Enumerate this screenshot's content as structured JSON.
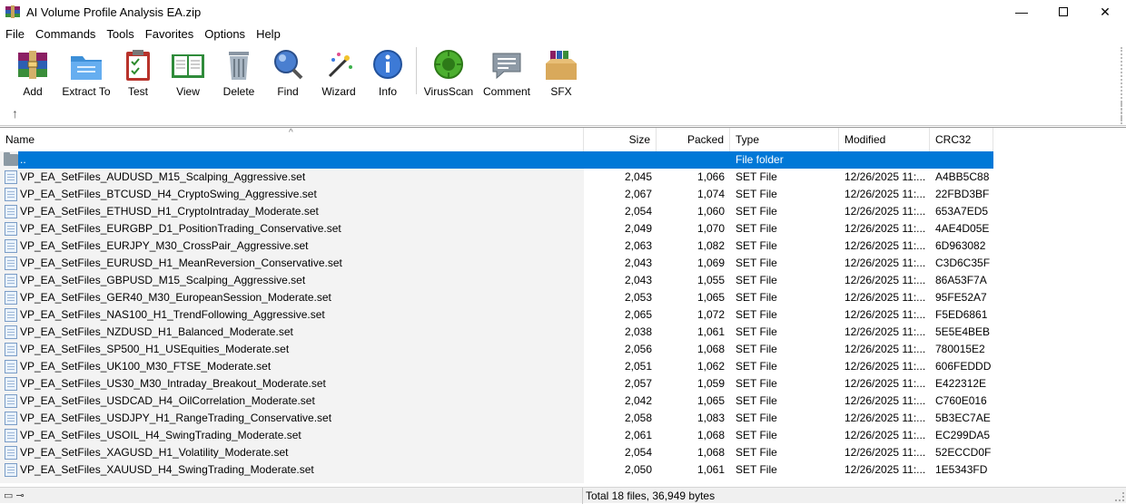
{
  "window": {
    "title": "AI Volume Profile Analysis EA.zip",
    "minimize": "—",
    "close": "✕"
  },
  "menu": [
    "File",
    "Commands",
    "Tools",
    "Favorites",
    "Options",
    "Help"
  ],
  "toolbar": [
    {
      "label": "Add",
      "icon": "add-archive-icon"
    },
    {
      "label": "Extract To",
      "icon": "extract-folder-icon"
    },
    {
      "label": "Test",
      "icon": "test-clipboard-icon"
    },
    {
      "label": "View",
      "icon": "view-book-icon"
    },
    {
      "label": "Delete",
      "icon": "trash-can-icon"
    },
    {
      "label": "Find",
      "icon": "magnifier-icon"
    },
    {
      "label": "Wizard",
      "icon": "magic-wand-icon"
    },
    {
      "label": "Info",
      "icon": "info-icon"
    },
    {
      "label": "VirusScan",
      "icon": "virus-scan-icon"
    },
    {
      "label": "Comment",
      "icon": "comment-icon"
    },
    {
      "label": "SFX",
      "icon": "sfx-box-icon"
    }
  ],
  "columns": {
    "name": "Name",
    "size": "Size",
    "packed": "Packed",
    "type": "Type",
    "modified": "Modified",
    "crc": "CRC32"
  },
  "parent_row": {
    "name": "..",
    "type": "File folder"
  },
  "files": [
    {
      "name": "VP_EA_SetFiles_AUDUSD_M15_Scalping_Aggressive.set",
      "size": "2,045",
      "packed": "1,066",
      "type": "SET File",
      "modified": "12/26/2025 11:...",
      "crc": "A4BB5C88"
    },
    {
      "name": "VP_EA_SetFiles_BTCUSD_H4_CryptoSwing_Aggressive.set",
      "size": "2,067",
      "packed": "1,074",
      "type": "SET File",
      "modified": "12/26/2025 11:...",
      "crc": "22FBD3BF"
    },
    {
      "name": "VP_EA_SetFiles_ETHUSD_H1_CryptoIntraday_Moderate.set",
      "size": "2,054",
      "packed": "1,060",
      "type": "SET File",
      "modified": "12/26/2025 11:...",
      "crc": "653A7ED5"
    },
    {
      "name": "VP_EA_SetFiles_EURGBP_D1_PositionTrading_Conservative.set",
      "size": "2,049",
      "packed": "1,070",
      "type": "SET File",
      "modified": "12/26/2025 11:...",
      "crc": "4AE4D05E"
    },
    {
      "name": "VP_EA_SetFiles_EURJPY_M30_CrossPair_Aggressive.set",
      "size": "2,063",
      "packed": "1,082",
      "type": "SET File",
      "modified": "12/26/2025 11:...",
      "crc": "6D963082"
    },
    {
      "name": "VP_EA_SetFiles_EURUSD_H1_MeanReversion_Conservative.set",
      "size": "2,043",
      "packed": "1,069",
      "type": "SET File",
      "modified": "12/26/2025 11:...",
      "crc": "C3D6C35F"
    },
    {
      "name": "VP_EA_SetFiles_GBPUSD_M15_Scalping_Aggressive.set",
      "size": "2,043",
      "packed": "1,055",
      "type": "SET File",
      "modified": "12/26/2025 11:...",
      "crc": "86A53F7A"
    },
    {
      "name": "VP_EA_SetFiles_GER40_M30_EuropeanSession_Moderate.set",
      "size": "2,053",
      "packed": "1,065",
      "type": "SET File",
      "modified": "12/26/2025 11:...",
      "crc": "95FE52A7"
    },
    {
      "name": "VP_EA_SetFiles_NAS100_H1_TrendFollowing_Aggressive.set",
      "size": "2,065",
      "packed": "1,072",
      "type": "SET File",
      "modified": "12/26/2025 11:...",
      "crc": "F5ED6861"
    },
    {
      "name": "VP_EA_SetFiles_NZDUSD_H1_Balanced_Moderate.set",
      "size": "2,038",
      "packed": "1,061",
      "type": "SET File",
      "modified": "12/26/2025 11:...",
      "crc": "5E5E4BEB"
    },
    {
      "name": "VP_EA_SetFiles_SP500_H1_USEquities_Moderate.set",
      "size": "2,056",
      "packed": "1,068",
      "type": "SET File",
      "modified": "12/26/2025 11:...",
      "crc": "780015E2"
    },
    {
      "name": "VP_EA_SetFiles_UK100_M30_FTSE_Moderate.set",
      "size": "2,051",
      "packed": "1,062",
      "type": "SET File",
      "modified": "12/26/2025 11:...",
      "crc": "606FEDDD"
    },
    {
      "name": "VP_EA_SetFiles_US30_M30_Intraday_Breakout_Moderate.set",
      "size": "2,057",
      "packed": "1,059",
      "type": "SET File",
      "modified": "12/26/2025 11:...",
      "crc": "E422312E"
    },
    {
      "name": "VP_EA_SetFiles_USDCAD_H4_OilCorrelation_Moderate.set",
      "size": "2,042",
      "packed": "1,065",
      "type": "SET File",
      "modified": "12/26/2025 11:...",
      "crc": "C760E016"
    },
    {
      "name": "VP_EA_SetFiles_USDJPY_H1_RangeTrading_Conservative.set",
      "size": "2,058",
      "packed": "1,083",
      "type": "SET File",
      "modified": "12/26/2025 11:...",
      "crc": "5B3EC7AE"
    },
    {
      "name": "VP_EA_SetFiles_USOIL_H4_SwingTrading_Moderate.set",
      "size": "2,061",
      "packed": "1,068",
      "type": "SET File",
      "modified": "12/26/2025 11:...",
      "crc": "EC299DA5"
    },
    {
      "name": "VP_EA_SetFiles_XAGUSD_H1_Volatility_Moderate.set",
      "size": "2,054",
      "packed": "1,068",
      "type": "SET File",
      "modified": "12/26/2025 11:...",
      "crc": "52ECCD0F"
    },
    {
      "name": "VP_EA_SetFiles_XAUUSD_H4_SwingTrading_Moderate.set",
      "size": "2,050",
      "packed": "1,061",
      "type": "SET File",
      "modified": "12/26/2025 11:...",
      "crc": "1E5343FD"
    }
  ],
  "status": {
    "summary": "Total 18 files, 36,949 bytes"
  },
  "colors": {
    "selection": "#0078d7"
  }
}
